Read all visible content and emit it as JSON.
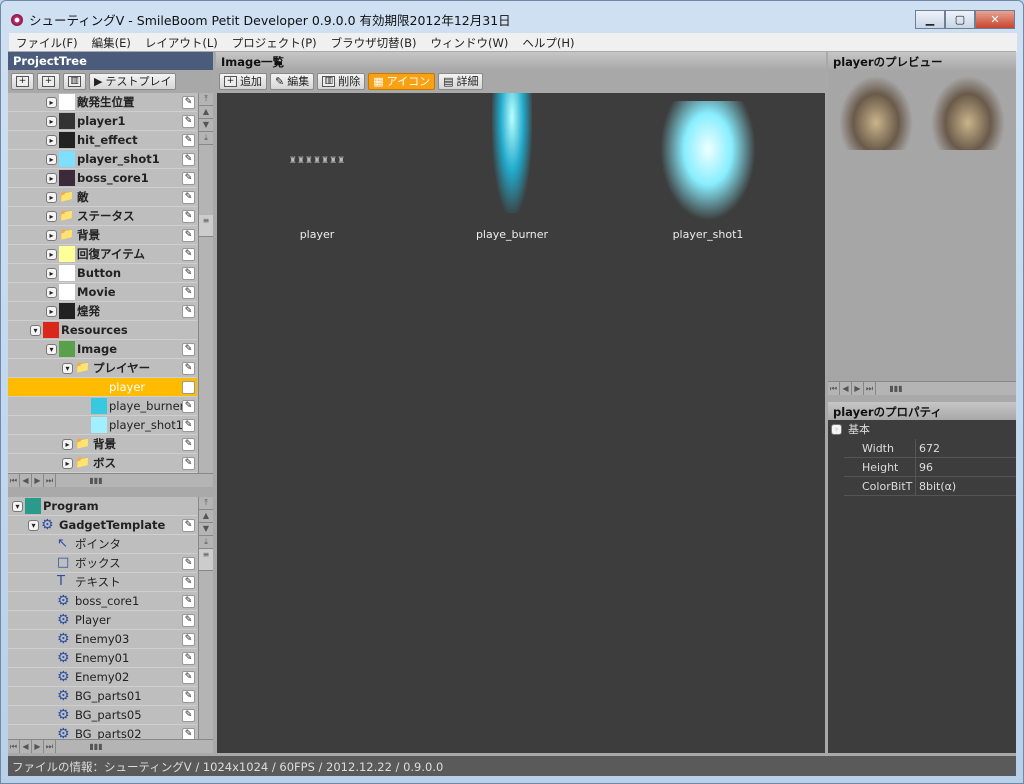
{
  "window": {
    "title": "シューティングV - SmileBoom Petit Developer 0.9.0.0 有効期限2012年12月31日",
    "min": "▁",
    "max": "▢",
    "close": "✕"
  },
  "menu": [
    "ファイル(F)",
    "編集(E)",
    "レイアウト(L)",
    "プロジェクト(P)",
    "ブラウザ切替(B)",
    "ウィンドウ(W)",
    "ヘルプ(H)"
  ],
  "project_tree": {
    "title": "ProjectTree",
    "testplay": "テストプレイ",
    "items": [
      {
        "label": "敵発生位置",
        "lvl": 2,
        "thumb": "#ffffff",
        "exp": "▸"
      },
      {
        "label": "player1",
        "lvl": 2,
        "thumb": "#333333",
        "exp": "▸"
      },
      {
        "label": "hit_effect",
        "lvl": 2,
        "thumb": "#222222",
        "exp": "▸"
      },
      {
        "label": "player_shot1",
        "lvl": 2,
        "thumb": "#7fdfff",
        "exp": "▸"
      },
      {
        "label": "boss_core1",
        "lvl": 2,
        "thumb": "#3a2a3a",
        "exp": "▸"
      },
      {
        "label": "敵",
        "lvl": 2,
        "thumb": "folder",
        "exp": "▸"
      },
      {
        "label": "ステータス",
        "lvl": 2,
        "thumb": "folder",
        "exp": "▸"
      },
      {
        "label": "背景",
        "lvl": 2,
        "thumb": "folder",
        "exp": "▸"
      },
      {
        "label": "回復アイテム",
        "lvl": 2,
        "thumb": "#ffff99",
        "exp": "▸"
      },
      {
        "label": "Button",
        "lvl": 2,
        "thumb": "#ffffff",
        "exp": "▸"
      },
      {
        "label": "Movie",
        "lvl": 2,
        "thumb": "#ffffff",
        "exp": "▸"
      },
      {
        "label": "煌発",
        "lvl": 2,
        "thumb": "#222222",
        "exp": "▸"
      },
      {
        "label": "Resources",
        "lvl": 1,
        "thumb": "#d9271b",
        "exp": "▾",
        "nopen": true
      },
      {
        "label": "Image",
        "lvl": 2,
        "thumb": "#5aa04a",
        "exp": "▾"
      },
      {
        "label": "プレイヤー",
        "lvl": 3,
        "thumb": "folder",
        "exp": "▾"
      },
      {
        "label": "player",
        "lvl": 4,
        "thumb": "none",
        "sel": true
      },
      {
        "label": "playe_burner",
        "lvl": 4,
        "thumb": "#38c8e0",
        "norm": true
      },
      {
        "label": "player_shot1",
        "lvl": 4,
        "thumb": "#a0f0ff",
        "norm": true
      },
      {
        "label": "背景",
        "lvl": 3,
        "thumb": "folder",
        "exp": "▸"
      },
      {
        "label": "ボス",
        "lvl": 3,
        "thumb": "folder",
        "exp": "▸"
      }
    ]
  },
  "program_tree": {
    "items": [
      {
        "label": "Program",
        "lvl": 0,
        "thumb": "#2a9a8a",
        "exp": "▾",
        "nopen": true
      },
      {
        "label": "GadgetTemplate",
        "lvl": 1,
        "thumb": "gear",
        "exp": "▾"
      },
      {
        "label": "ポインタ",
        "lvl": 2,
        "thumb": "↖",
        "norm": true,
        "nopen": true
      },
      {
        "label": "ボックス",
        "lvl": 2,
        "thumb": "□",
        "norm": true
      },
      {
        "label": "テキスト",
        "lvl": 2,
        "thumb": "T",
        "norm": true
      },
      {
        "label": "boss_core1",
        "lvl": 2,
        "thumb": "gear",
        "norm": true
      },
      {
        "label": "Player",
        "lvl": 2,
        "thumb": "gear",
        "norm": true
      },
      {
        "label": "Enemy03",
        "lvl": 2,
        "thumb": "gear",
        "norm": true
      },
      {
        "label": "Enemy01",
        "lvl": 2,
        "thumb": "gear",
        "norm": true
      },
      {
        "label": "Enemy02",
        "lvl": 2,
        "thumb": "gear",
        "norm": true
      },
      {
        "label": "BG_parts01",
        "lvl": 2,
        "thumb": "gear",
        "norm": true
      },
      {
        "label": "BG_parts05",
        "lvl": 2,
        "thumb": "gear",
        "norm": true
      },
      {
        "label": "BG_parts02",
        "lvl": 2,
        "thumb": "gear",
        "norm": true
      }
    ]
  },
  "image_list": {
    "title": "Image一覧",
    "add": "追加",
    "edit": "編集",
    "delete": "削除",
    "icon_view": "アイコン",
    "detail_view": "詳細",
    "images": [
      {
        "name": "player"
      },
      {
        "name": "playe_burner"
      },
      {
        "name": "player_shot1"
      }
    ]
  },
  "preview": {
    "title": "playerのプレビュー"
  },
  "properties": {
    "title": "playerのプロパティ",
    "group": "基本",
    "rows": [
      {
        "k": "Width",
        "v": "672"
      },
      {
        "k": "Height",
        "v": "96"
      },
      {
        "k": "ColorBitT",
        "v": "8bit(α)"
      }
    ]
  },
  "status": "ファイルの情報：シューティングV / 1024x1024 / 60FPS / 2012.12.22 / 0.9.0.0"
}
